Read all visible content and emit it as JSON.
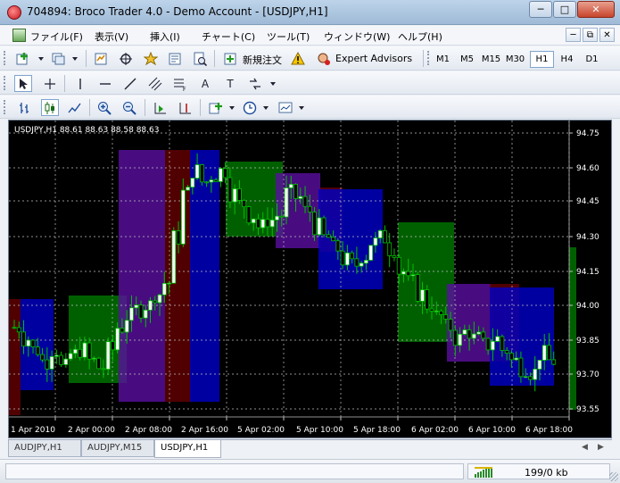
{
  "window": {
    "title": "704894: Broco Trader 4.0 - Demo Account - [USDJPY,H1]",
    "minimize": "─",
    "maximize": "□",
    "close": "✕"
  },
  "menu": {
    "items": [
      "ファイル(F)",
      "表示(V)",
      "挿入(I)",
      "チャート(C)",
      "ツール(T)",
      "ウィンドウ(W)",
      "ヘルプ(H)"
    ],
    "mdi": [
      "─",
      "⧉",
      "✕"
    ]
  },
  "toolbar": {
    "new_order": "新規注文",
    "expert_advisors": "Expert Advisors",
    "timeframes": [
      "M1",
      "M5",
      "M15",
      "M30",
      "H1",
      "H4",
      "D1"
    ],
    "active_timeframe": "H1",
    "draw_text_tool": "A",
    "text_label_tool": "T"
  },
  "chart": {
    "header": "USDJPY,H1  88.61 88.63 88.58 88.63",
    "colors": {
      "background": "#000000",
      "grid": "#c0c0c0",
      "text": "#ffffff",
      "bull": "#ffffff",
      "bear": "#000000",
      "wick": "#00c000",
      "box_blue": "#0000c8",
      "box_purple": "#5a0fa0",
      "box_green": "#007800",
      "box_red": "#640000"
    }
  },
  "chart_data": {
    "type": "candlestick",
    "symbol": "USDJPY",
    "timeframe": "H1",
    "ylim": [
      93.5,
      94.8
    ],
    "y_ticks": [
      "94.75",
      "94.60",
      "94.45",
      "94.30",
      "94.15",
      "94.00",
      "93.85",
      "93.70",
      "93.55"
    ],
    "x_ticks": [
      "1 Apr 2010",
      "2 Apr 00:00",
      "2 Apr 08:00",
      "2 Apr 16:00",
      "5 Apr 02:00",
      "5 Apr 10:00",
      "5 Apr 18:00",
      "6 Apr 02:00",
      "6 Apr 10:00",
      "6 Apr 18:00"
    ],
    "grid": true,
    "last": {
      "open": 88.61,
      "high": 88.63,
      "low": 88.58,
      "close": 88.63
    }
  },
  "tabs": {
    "items": [
      "AUDJPY,H1",
      "AUDJPY,M15",
      "USDJPY,H1"
    ],
    "active": "USDJPY,H1",
    "left_arrow": "◀",
    "right_arrow": "▶"
  },
  "status": {
    "traffic": "199/0 kb"
  }
}
